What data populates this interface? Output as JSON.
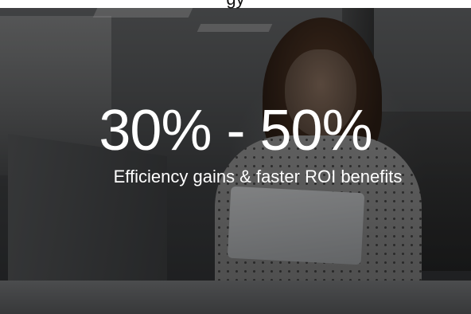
{
  "hero": {
    "headline": "30% - 50%",
    "subline": "Efficiency gains & faster ROI benefits",
    "top_strip_text": "gy",
    "text_color": "#ffffff",
    "overlay_color": "#000000"
  }
}
